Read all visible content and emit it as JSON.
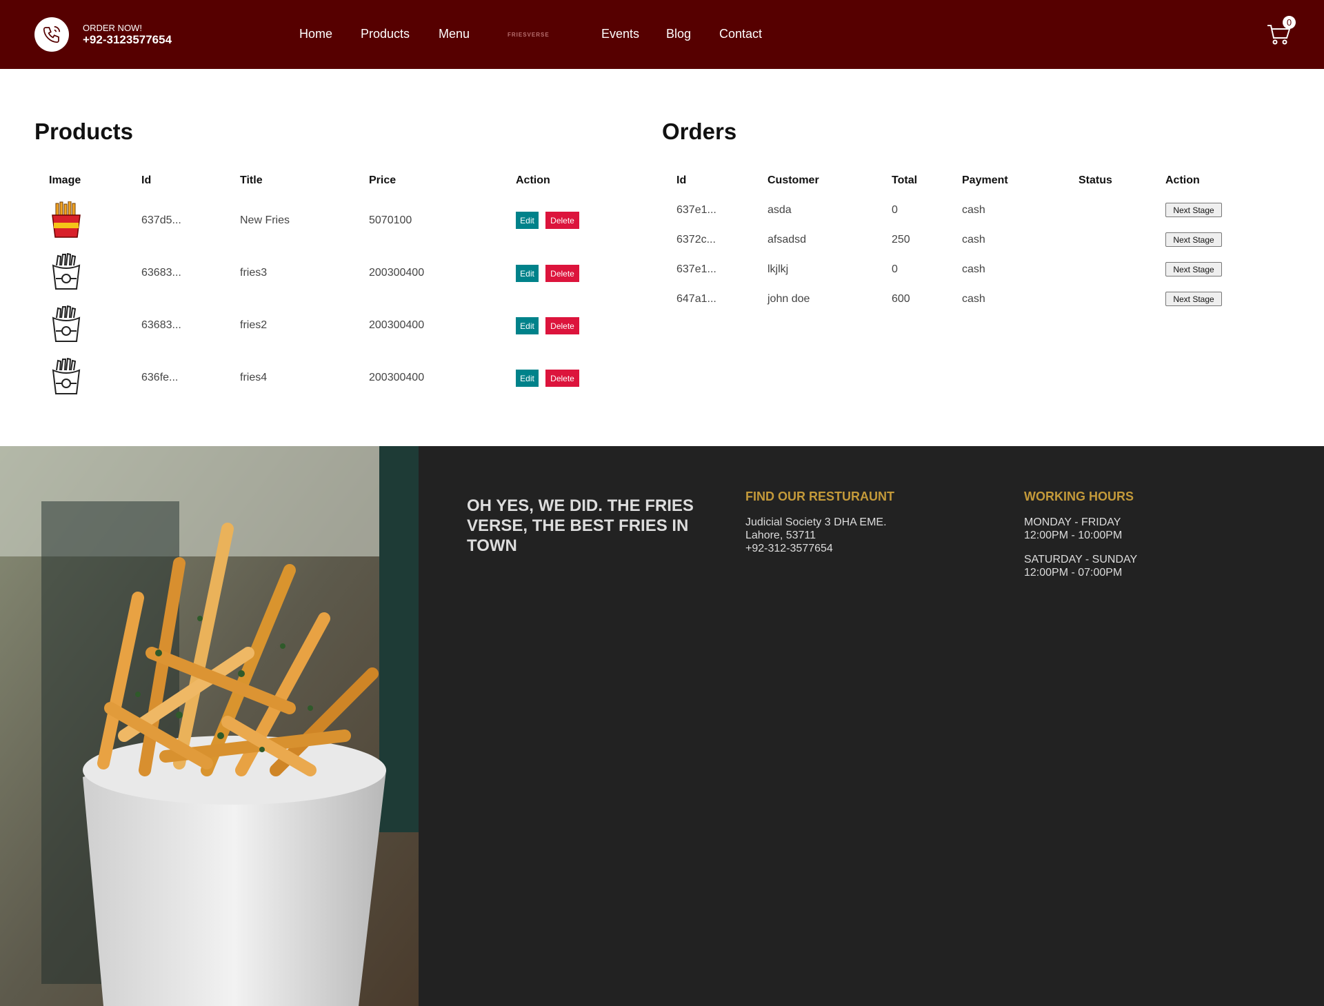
{
  "header": {
    "order_now": "ORDER NOW!",
    "phone": "+92-3123577654",
    "nav": [
      "Home",
      "Products",
      "Menu",
      "Events",
      "Blog",
      "Contact"
    ],
    "logo_text": "FRIESVERSE",
    "cart_count": "0"
  },
  "products": {
    "title": "Products",
    "columns": [
      "Image",
      "Id",
      "Title",
      "Price",
      "Action"
    ],
    "rows": [
      {
        "id": "637d5...",
        "title": "New Fries",
        "price": "5070100",
        "image_icon": "fries-color-icon"
      },
      {
        "id": "63683...",
        "title": "fries3",
        "price": "200300400",
        "image_icon": "fries-outline-icon"
      },
      {
        "id": "63683...",
        "title": "fries2",
        "price": "200300400",
        "image_icon": "fries-outline-icon"
      },
      {
        "id": "636fe...",
        "title": "fries4",
        "price": "200300400",
        "image_icon": "fries-outline-icon"
      }
    ],
    "edit_label": "Edit",
    "delete_label": "Delete"
  },
  "orders": {
    "title": "Orders",
    "columns": [
      "Id",
      "Customer",
      "Total",
      "Payment",
      "Status",
      "Action"
    ],
    "rows": [
      {
        "id": "637e1...",
        "customer": "asda",
        "total": "0",
        "payment": "cash",
        "status": ""
      },
      {
        "id": "6372c...",
        "customer": "afsadsd",
        "total": "250",
        "payment": "cash",
        "status": ""
      },
      {
        "id": "637e1...",
        "customer": "lkjlkj",
        "total": "0",
        "payment": "cash",
        "status": ""
      },
      {
        "id": "647a1...",
        "customer": "john doe",
        "total": "600",
        "payment": "cash",
        "status": ""
      }
    ],
    "next_stage_label": "Next Stage"
  },
  "footer": {
    "tagline": "OH YES, WE DID. THE FRIES VERSE, THE BEST FRIES IN TOWN",
    "find_heading": "FIND OUR RESTURAUNT",
    "address_line1": "Judicial Society 3 DHA EME.",
    "address_line2": "Lahore, 53711",
    "address_phone": "+92-312-3577654",
    "hours_heading": "WORKING HOURS",
    "weekday_label": "MONDAY - FRIDAY",
    "weekday_hours": "12:00PM - 10:00PM",
    "weekend_label": "SATURDAY - SUNDAY",
    "weekend_hours": "12:00PM - 07:00PM"
  },
  "colors": {
    "navbar": "#560000",
    "edit_button": "#00828a",
    "delete_button": "#dc143c",
    "footer_dark": "#222222",
    "footer_heading": "#c49a3a"
  }
}
